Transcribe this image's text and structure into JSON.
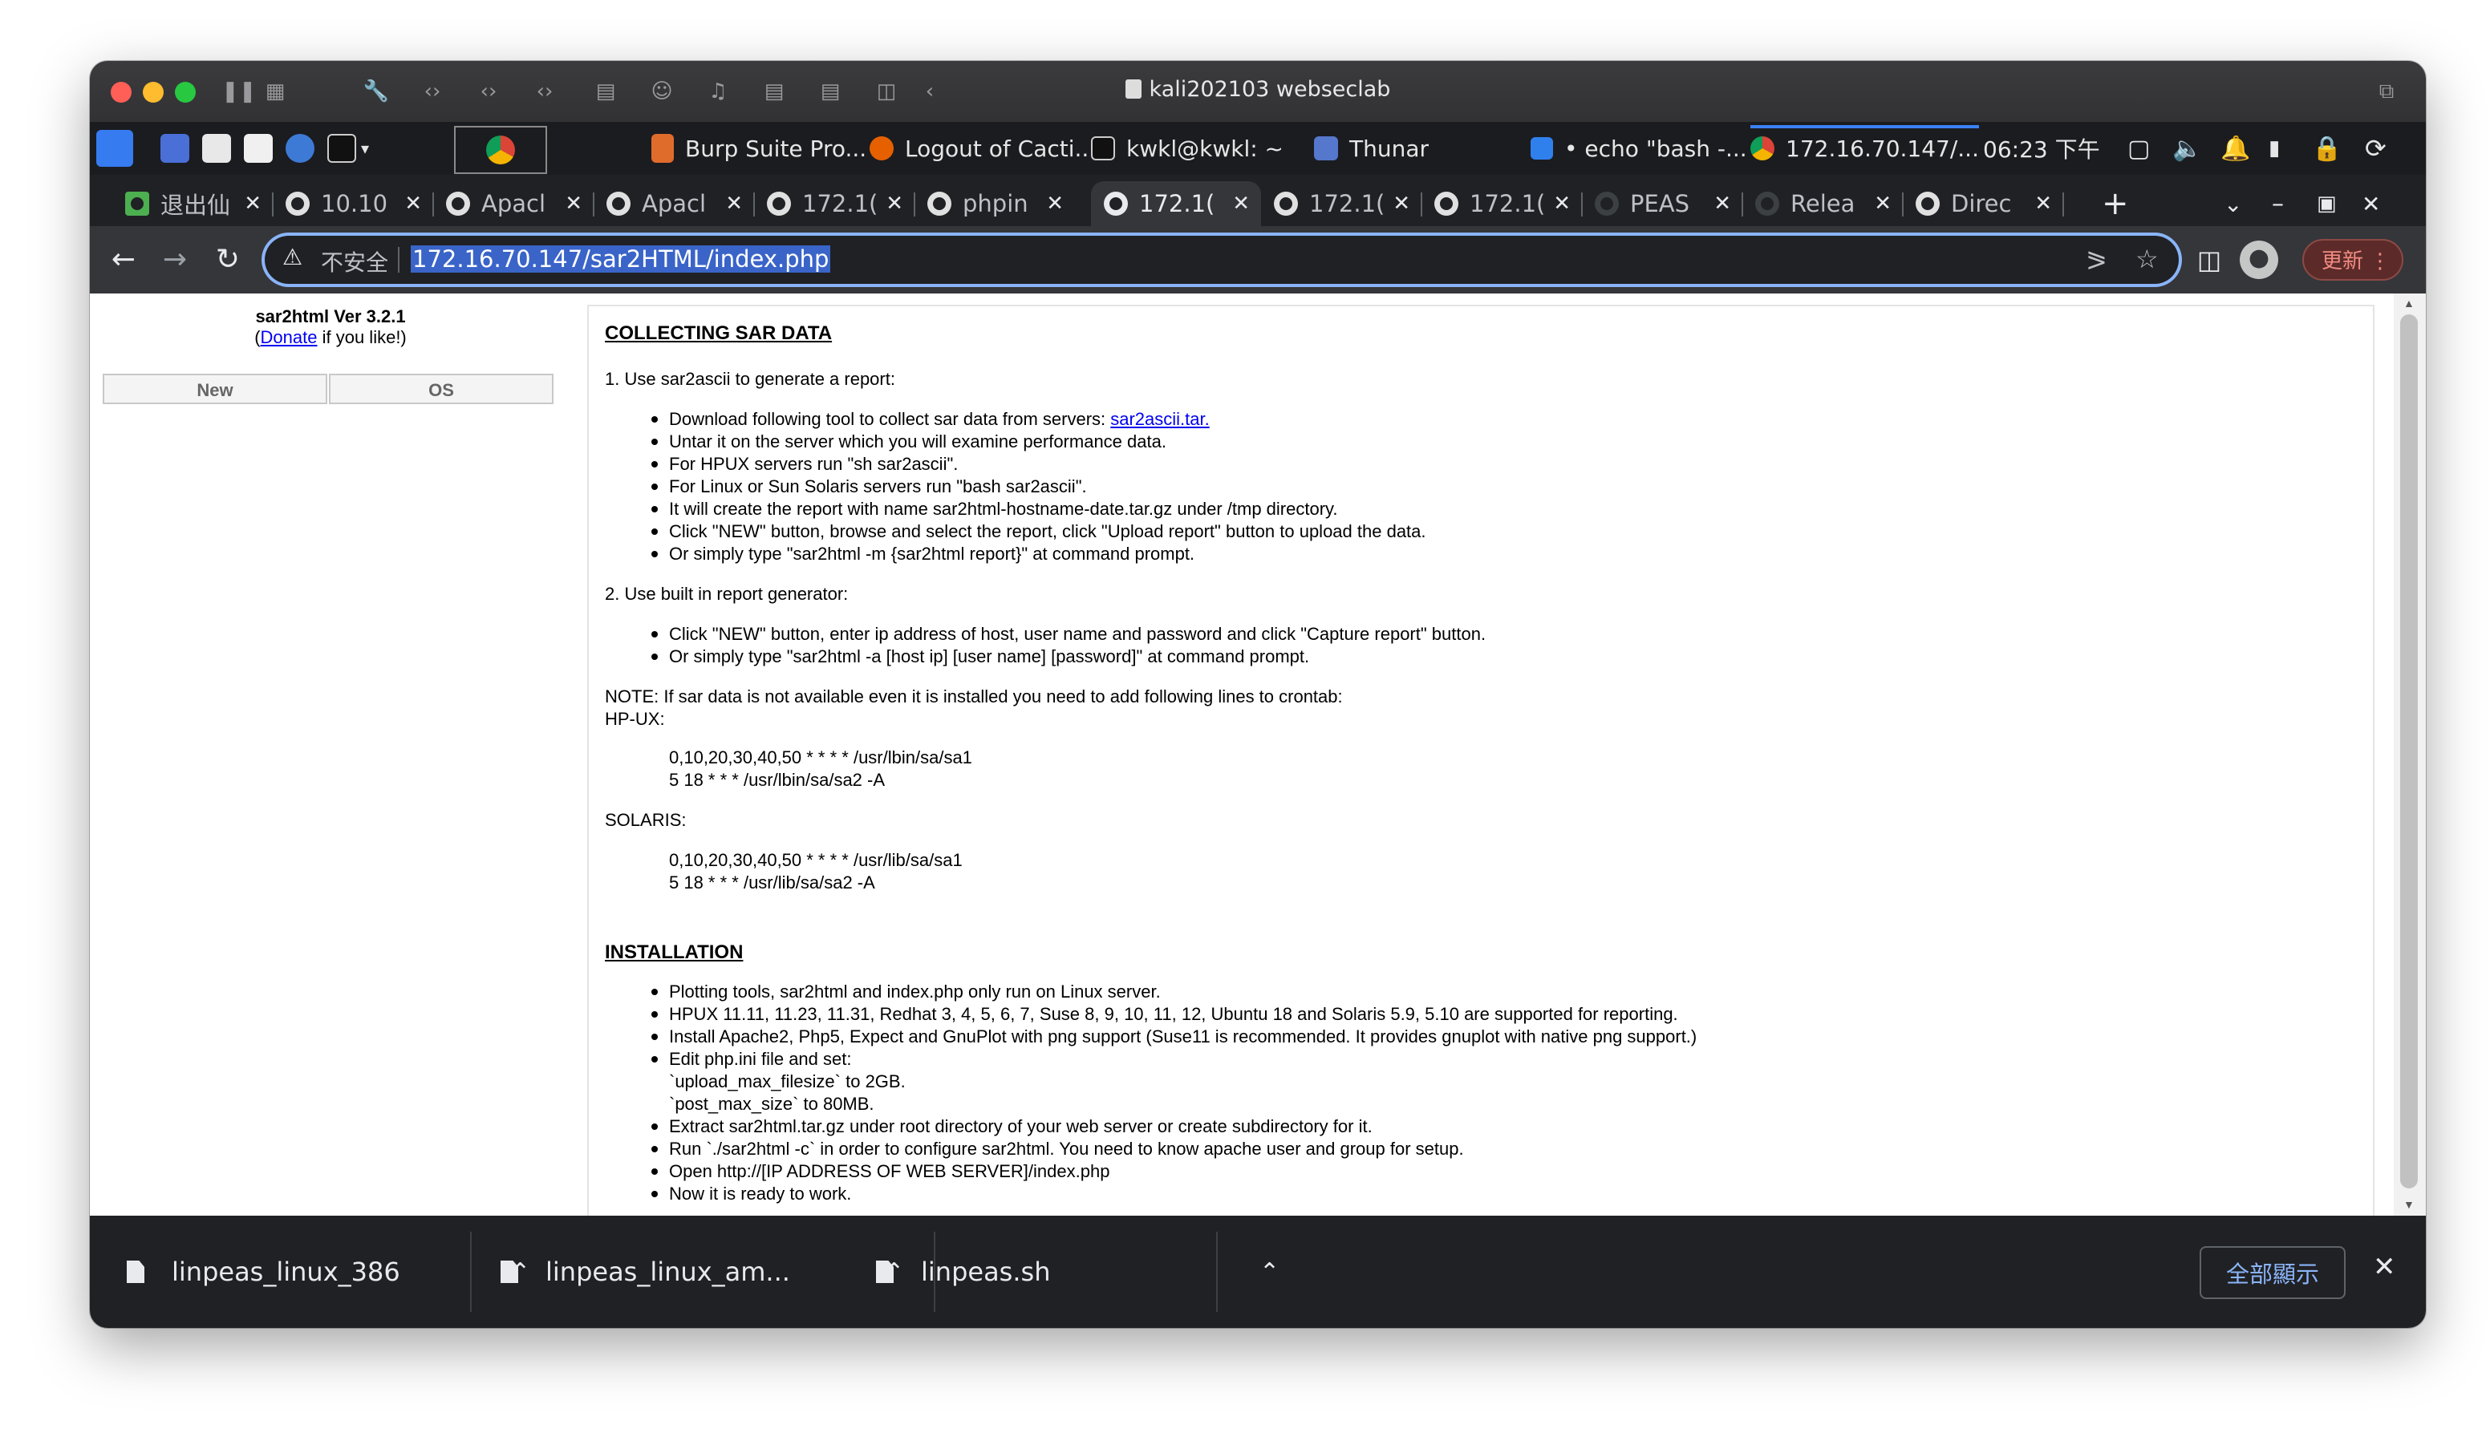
{
  "window": {
    "title": "kali202103 webseclab"
  },
  "panel": {
    "items": [
      {
        "label": "Burp Suite Pro..."
      },
      {
        "label": "Logout of Cacti..."
      },
      {
        "label": "kwkl@kwkl: ~"
      },
      {
        "label": "Thunar"
      },
      {
        "label": "• echo \"bash -..."
      },
      {
        "label": "172.16.70.147/..."
      }
    ],
    "clock": "06:23 下午"
  },
  "tabs": [
    {
      "label": "退出仙"
    },
    {
      "label": "10.10"
    },
    {
      "label": "Apacl"
    },
    {
      "label": "Apacl"
    },
    {
      "label": "172.1("
    },
    {
      "label": "phpin"
    },
    {
      "label": "172.1("
    },
    {
      "label": "172.1("
    },
    {
      "label": "172.1("
    },
    {
      "label": "PEAS"
    },
    {
      "label": "Relea"
    },
    {
      "label": "Direc"
    }
  ],
  "toolbar": {
    "insecure_label": "不安全",
    "url": "172.16.70.147/sar2HTML/index.php",
    "update_label": "更新"
  },
  "sidebar": {
    "version": "sar2html Ver 3.2.1",
    "donate_prefix": "(",
    "donate_link": "Donate",
    "donate_suffix": " if you like!)",
    "new_button": "New",
    "os_button": "OS"
  },
  "main": {
    "collect_heading": "COLLECTING SAR DATA",
    "step1": "1. Use sar2ascii to generate a report:",
    "step1_bullets": [
      "Download following tool to collect sar data from servers: ",
      "Untar it on the server which you will examine performance data.",
      "For HPUX servers run \"sh sar2ascii\".",
      "For Linux or Sun Solaris servers run \"bash sar2ascii\".",
      "It will create the report with name sar2html-hostname-date.tar.gz under /tmp directory.",
      "Click \"NEW\" button, browse and select the report, click \"Upload report\" button to upload the data.",
      "Or simply type \"sar2html -m {sar2html report}\" at command prompt."
    ],
    "sar2ascii_link": "sar2ascii.tar.",
    "step2": "2. Use built in report generator:",
    "step2_bullets": [
      "Click \"NEW\" button, enter ip address of host, user name and password and click \"Capture report\" button.",
      "Or simply type \"sar2html -a [host ip] [user name] [password]\" at command prompt."
    ],
    "note": "NOTE: If sar data is not available even it is installed you need to add following lines to crontab:",
    "hpux_label": "HP-UX:",
    "hpux_lines": [
      "0,10,20,30,40,50 * * * * /usr/lbin/sa/sa1",
      "5 18 * * * /usr/lbin/sa/sa2 -A"
    ],
    "solaris_label": "SOLARIS:",
    "solaris_lines": [
      "0,10,20,30,40,50 * * * * /usr/lib/sa/sa1",
      "5 18 * * * /usr/lib/sa/sa2 -A"
    ],
    "install_heading": "INSTALLATION",
    "install_bullets": [
      "Plotting tools, sar2html and index.php only run on Linux server.",
      "HPUX 11.11, 11.23, 11.31, Redhat 3, 4, 5, 6, 7, Suse 8, 9, 10, 11, 12, Ubuntu 18 and Solaris 5.9, 5.10 are supported for reporting.",
      "Install Apache2, Php5, Expect and GnuPlot with png support (Suse11 is recommended. It provides gnuplot with native png support.)",
      "Edit php.ini file and set:",
      "Extract sar2html.tar.gz under root directory of your web server or create subdirectory for it.",
      "Run `./sar2html -c` in order to configure sar2html. You need to know apache user and group for setup.",
      "Open http://[IP ADDRESS OF WEB SERVER]/index.php",
      "Now it is ready to work."
    ],
    "php_settings": [
      "`upload_max_filesize` to 2GB.",
      "`post_max_size` to 80MB."
    ]
  },
  "downloads": {
    "items": [
      {
        "name": "linpeas_linux_386"
      },
      {
        "name": "linpeas_linux_am..."
      },
      {
        "name": "linpeas.sh"
      }
    ],
    "show_all": "全部顯示"
  },
  "colors": {
    "chrome_dark": "#202124",
    "toolbar": "#35363a",
    "focus_ring": "#8ab4f8",
    "link": "#0000ee"
  }
}
